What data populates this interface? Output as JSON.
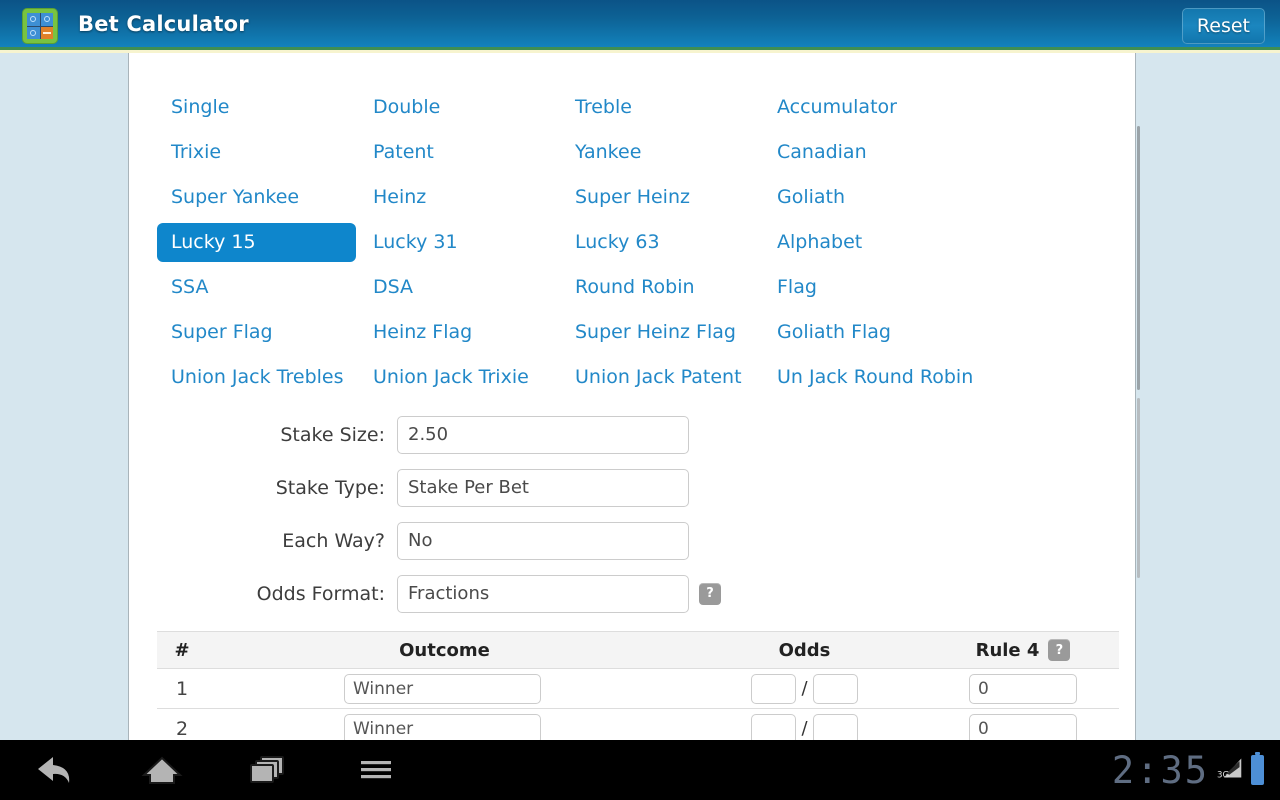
{
  "appbar": {
    "title": "Bet Calculator",
    "reset_label": "Reset",
    "icon": "bet-calculator-app-icon",
    "bg_top": "#0b5387",
    "bg_bottom": "#1686c2"
  },
  "bet_types": {
    "selected": "Lucky 15",
    "link_color": "#2288c8",
    "selected_bg": "#0e86cc",
    "rows": [
      [
        "Single",
        "Double",
        "Treble",
        "Accumulator"
      ],
      [
        "Trixie",
        "Patent",
        "Yankee",
        "Canadian"
      ],
      [
        "Super Yankee",
        "Heinz",
        "Super Heinz",
        "Goliath"
      ],
      [
        "Lucky 15",
        "Lucky 31",
        "Lucky 63",
        "Alphabet"
      ],
      [
        "SSA",
        "DSA",
        "Round Robin",
        "Flag"
      ],
      [
        "Super Flag",
        "Heinz Flag",
        "Super Heinz Flag",
        "Goliath Flag"
      ],
      [
        "Union Jack Trebles",
        "Union Jack Trixie",
        "Union Jack Patent",
        "Un Jack Round Robin"
      ]
    ]
  },
  "settings": {
    "fields": [
      {
        "label": "Stake Size:",
        "value": "2.50",
        "help": false
      },
      {
        "label": "Stake Type:",
        "value": "Stake Per Bet",
        "help": false
      },
      {
        "label": "Each Way?",
        "value": "No",
        "help": false
      },
      {
        "label": "Odds Format:",
        "value": "Fractions",
        "help": true
      }
    ],
    "help_glyph": "?"
  },
  "bets_table": {
    "headers": {
      "num": "#",
      "outcome": "Outcome",
      "odds": "Odds",
      "rule4": "Rule 4"
    },
    "rule4_help_glyph": "?",
    "odds_separator": "/",
    "rows": [
      {
        "num": "1",
        "outcome": "Winner",
        "odds_num": "",
        "odds_den": "",
        "rule4": "0"
      },
      {
        "num": "2",
        "outcome": "Winner",
        "odds_num": "",
        "odds_den": "",
        "rule4": "0"
      }
    ]
  },
  "navbar": {
    "back": "back-icon",
    "home": "home-icon",
    "recents": "recent-apps-icon",
    "menu": "menu-icon",
    "clock": "2:35",
    "network": "3G",
    "battery": "battery-icon"
  }
}
